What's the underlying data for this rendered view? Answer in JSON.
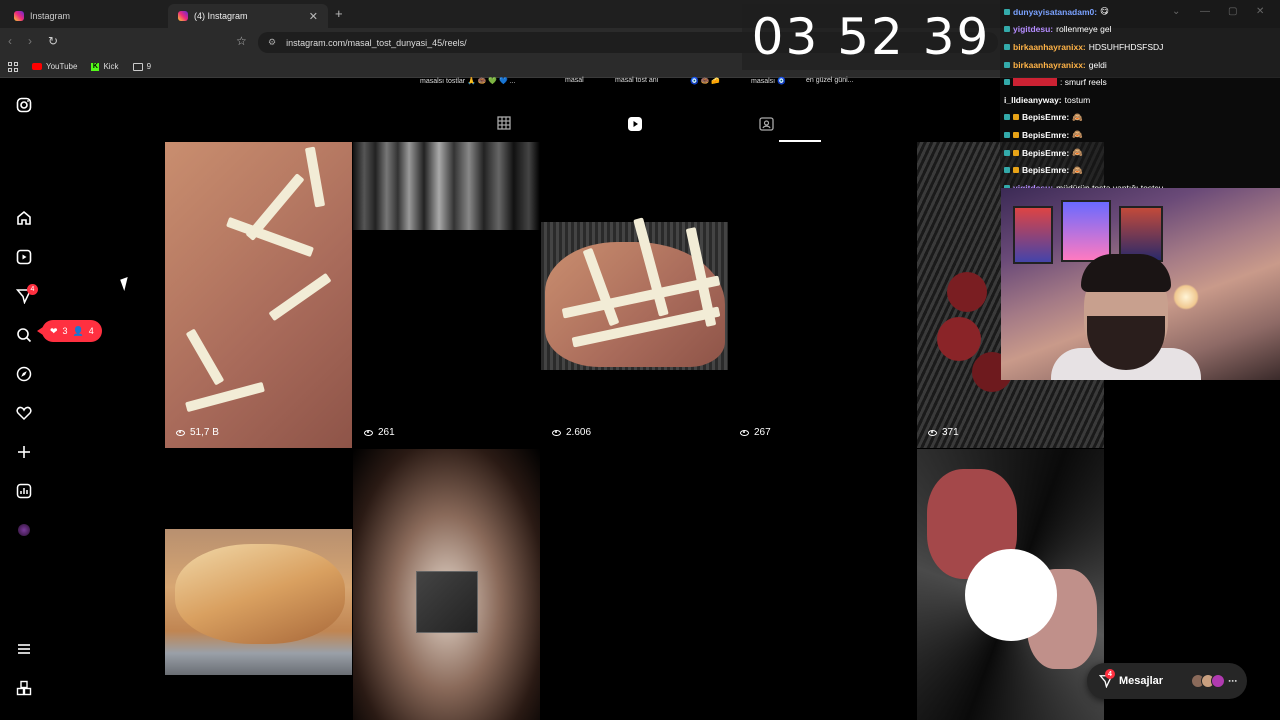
{
  "browser": {
    "tabs": [
      {
        "title": "Instagram"
      },
      {
        "title": "(4) Instagram"
      }
    ],
    "url": "instagram.com/masal_tost_dunyasi_45/reels/",
    "bookmarks": [
      {
        "label": "YouTube"
      },
      {
        "label": "Kick"
      },
      {
        "label": "9"
      }
    ]
  },
  "sidenav": {
    "items": [
      "instagram-logo",
      "home",
      "reels",
      "messages",
      "search",
      "explore",
      "notifications",
      "create",
      "dashboard",
      "profile",
      "more",
      "also-from-meta"
    ],
    "messages_badge": "4",
    "notif_pill": {
      "likes": "3",
      "followers": "4"
    }
  },
  "profile": {
    "highlights": [
      "masalsı tostlar 🙏 🍩 💚 💙 ...",
      "masal",
      "masal tost anı",
      "🧿 🍩 🧀",
      "masalsı 🧿",
      "en güzel güni..."
    ],
    "tabs": [
      "posts",
      "reels",
      "tagged"
    ],
    "active_tab": "reels"
  },
  "reels": [
    {
      "views": "51,7 B",
      "kind": "toast-cheese-star"
    },
    {
      "views": "261",
      "kind": "streak"
    },
    {
      "views": "2.606",
      "kind": "toast-cheese-lattice"
    },
    {
      "views": "267",
      "kind": "black"
    },
    {
      "views": "371",
      "kind": "sausage"
    },
    {
      "views": "",
      "kind": "grilled-toast"
    },
    {
      "views": "",
      "kind": "blurred"
    },
    {
      "views": "",
      "kind": "black"
    },
    {
      "views": "",
      "kind": "black"
    },
    {
      "views": "",
      "kind": "sliced-toast"
    }
  ],
  "stream": {
    "timer": "03 52 39",
    "chat": [
      {
        "user": "dunyayisatanadam0:",
        "text": "😋",
        "color": "#7aa2ff"
      },
      {
        "user": "yigitdesu:",
        "text": "rollenmeye gel",
        "color": "#b58cff"
      },
      {
        "user": "birkaanhayranixx:",
        "text": "HDSUHFHDSFSDJ",
        "color": "#ffb347"
      },
      {
        "user": "birkaanhayranixx:",
        "text": "geldi",
        "color": "#ffb347"
      },
      {
        "user": "",
        "text": ": smurf reels",
        "color": "#ff3b3b"
      },
      {
        "user": "i_lldieanyway:",
        "text": "tostum",
        "color": "#ffffff"
      },
      {
        "user": "BepisEmre:",
        "text": "🙈",
        "color": "#f2f2f2"
      },
      {
        "user": "BepisEmre:",
        "text": "🙈",
        "color": "#f2f2f2"
      },
      {
        "user": "BepisEmre:",
        "text": "🙈",
        "color": "#f2f2f2"
      },
      {
        "user": "BepisEmre:",
        "text": "🙈",
        "color": "#f2f2f2"
      },
      {
        "user": "yigitdesu:",
        "text": "müdürün tosta yaptığı tostçu",
        "color": "#b58cff"
      }
    ]
  },
  "messages_button": {
    "label": "Mesajlar",
    "badge": "4"
  }
}
